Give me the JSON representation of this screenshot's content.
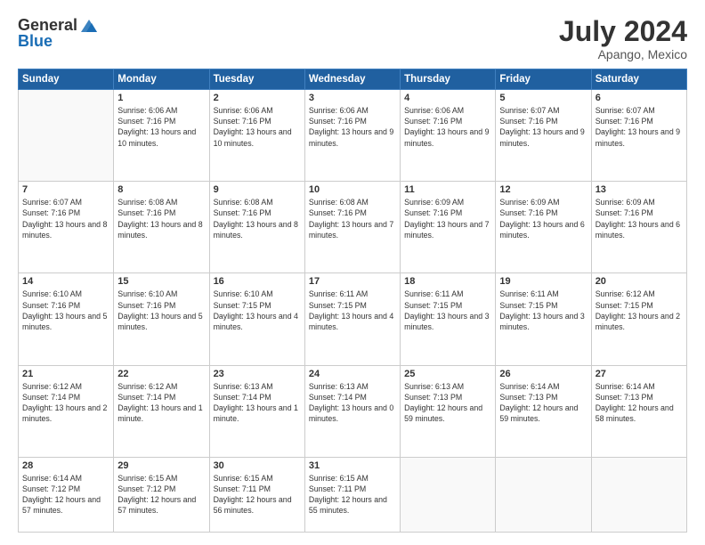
{
  "header": {
    "logo_general": "General",
    "logo_blue": "Blue",
    "month": "July 2024",
    "location": "Apango, Mexico"
  },
  "days_of_week": [
    "Sunday",
    "Monday",
    "Tuesday",
    "Wednesday",
    "Thursday",
    "Friday",
    "Saturday"
  ],
  "weeks": [
    [
      {
        "day": "",
        "info": ""
      },
      {
        "day": "1",
        "info": "Sunrise: 6:06 AM\nSunset: 7:16 PM\nDaylight: 13 hours\nand 10 minutes."
      },
      {
        "day": "2",
        "info": "Sunrise: 6:06 AM\nSunset: 7:16 PM\nDaylight: 13 hours\nand 10 minutes."
      },
      {
        "day": "3",
        "info": "Sunrise: 6:06 AM\nSunset: 7:16 PM\nDaylight: 13 hours\nand 9 minutes."
      },
      {
        "day": "4",
        "info": "Sunrise: 6:06 AM\nSunset: 7:16 PM\nDaylight: 13 hours\nand 9 minutes."
      },
      {
        "day": "5",
        "info": "Sunrise: 6:07 AM\nSunset: 7:16 PM\nDaylight: 13 hours\nand 9 minutes."
      },
      {
        "day": "6",
        "info": "Sunrise: 6:07 AM\nSunset: 7:16 PM\nDaylight: 13 hours\nand 9 minutes."
      }
    ],
    [
      {
        "day": "7",
        "info": "Sunrise: 6:07 AM\nSunset: 7:16 PM\nDaylight: 13 hours\nand 8 minutes."
      },
      {
        "day": "8",
        "info": "Sunrise: 6:08 AM\nSunset: 7:16 PM\nDaylight: 13 hours\nand 8 minutes."
      },
      {
        "day": "9",
        "info": "Sunrise: 6:08 AM\nSunset: 7:16 PM\nDaylight: 13 hours\nand 8 minutes."
      },
      {
        "day": "10",
        "info": "Sunrise: 6:08 AM\nSunset: 7:16 PM\nDaylight: 13 hours\nand 7 minutes."
      },
      {
        "day": "11",
        "info": "Sunrise: 6:09 AM\nSunset: 7:16 PM\nDaylight: 13 hours\nand 7 minutes."
      },
      {
        "day": "12",
        "info": "Sunrise: 6:09 AM\nSunset: 7:16 PM\nDaylight: 13 hours\nand 6 minutes."
      },
      {
        "day": "13",
        "info": "Sunrise: 6:09 AM\nSunset: 7:16 PM\nDaylight: 13 hours\nand 6 minutes."
      }
    ],
    [
      {
        "day": "14",
        "info": "Sunrise: 6:10 AM\nSunset: 7:16 PM\nDaylight: 13 hours\nand 5 minutes."
      },
      {
        "day": "15",
        "info": "Sunrise: 6:10 AM\nSunset: 7:16 PM\nDaylight: 13 hours\nand 5 minutes."
      },
      {
        "day": "16",
        "info": "Sunrise: 6:10 AM\nSunset: 7:15 PM\nDaylight: 13 hours\nand 4 minutes."
      },
      {
        "day": "17",
        "info": "Sunrise: 6:11 AM\nSunset: 7:15 PM\nDaylight: 13 hours\nand 4 minutes."
      },
      {
        "day": "18",
        "info": "Sunrise: 6:11 AM\nSunset: 7:15 PM\nDaylight: 13 hours\nand 3 minutes."
      },
      {
        "day": "19",
        "info": "Sunrise: 6:11 AM\nSunset: 7:15 PM\nDaylight: 13 hours\nand 3 minutes."
      },
      {
        "day": "20",
        "info": "Sunrise: 6:12 AM\nSunset: 7:15 PM\nDaylight: 13 hours\nand 2 minutes."
      }
    ],
    [
      {
        "day": "21",
        "info": "Sunrise: 6:12 AM\nSunset: 7:14 PM\nDaylight: 13 hours\nand 2 minutes."
      },
      {
        "day": "22",
        "info": "Sunrise: 6:12 AM\nSunset: 7:14 PM\nDaylight: 13 hours\nand 1 minute."
      },
      {
        "day": "23",
        "info": "Sunrise: 6:13 AM\nSunset: 7:14 PM\nDaylight: 13 hours\nand 1 minute."
      },
      {
        "day": "24",
        "info": "Sunrise: 6:13 AM\nSunset: 7:14 PM\nDaylight: 13 hours\nand 0 minutes."
      },
      {
        "day": "25",
        "info": "Sunrise: 6:13 AM\nSunset: 7:13 PM\nDaylight: 12 hours\nand 59 minutes."
      },
      {
        "day": "26",
        "info": "Sunrise: 6:14 AM\nSunset: 7:13 PM\nDaylight: 12 hours\nand 59 minutes."
      },
      {
        "day": "27",
        "info": "Sunrise: 6:14 AM\nSunset: 7:13 PM\nDaylight: 12 hours\nand 58 minutes."
      }
    ],
    [
      {
        "day": "28",
        "info": "Sunrise: 6:14 AM\nSunset: 7:12 PM\nDaylight: 12 hours\nand 57 minutes."
      },
      {
        "day": "29",
        "info": "Sunrise: 6:15 AM\nSunset: 7:12 PM\nDaylight: 12 hours\nand 57 minutes."
      },
      {
        "day": "30",
        "info": "Sunrise: 6:15 AM\nSunset: 7:11 PM\nDaylight: 12 hours\nand 56 minutes."
      },
      {
        "day": "31",
        "info": "Sunrise: 6:15 AM\nSunset: 7:11 PM\nDaylight: 12 hours\nand 55 minutes."
      },
      {
        "day": "",
        "info": ""
      },
      {
        "day": "",
        "info": ""
      },
      {
        "day": "",
        "info": ""
      }
    ]
  ]
}
